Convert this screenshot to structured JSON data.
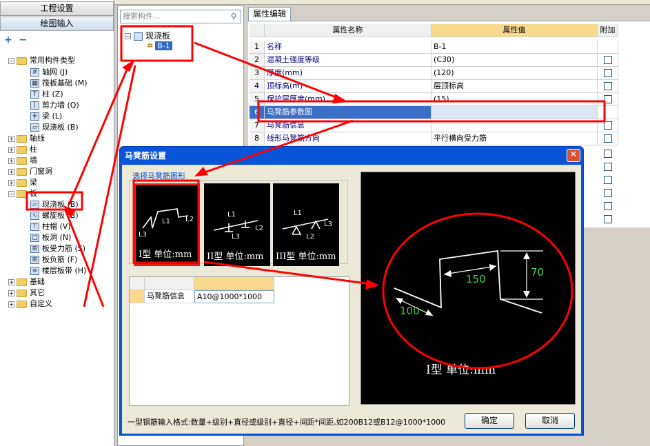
{
  "left_panel": {
    "btn_project": "工程设置",
    "btn_draw": "绘图输入",
    "tools": [
      "+",
      "−"
    ],
    "tree": [
      {
        "id": "n1",
        "exp": "−",
        "folder": true,
        "label": "常用构件类型"
      },
      {
        "id": "n2",
        "icon": "grid",
        "label": "轴网 (J)"
      },
      {
        "id": "n3",
        "icon": "raft",
        "label": "筏板基础 (M)"
      },
      {
        "id": "n4",
        "icon": "column",
        "label": "柱 (Z)"
      },
      {
        "id": "n5",
        "icon": "wall",
        "label": "剪力墙 (Q)"
      },
      {
        "id": "n6",
        "icon": "beam",
        "label": "梁 (L)"
      },
      {
        "id": "n7",
        "icon": "slab",
        "label": "现浇板 (B)"
      },
      {
        "id": "n8",
        "exp": "+",
        "folder": true,
        "label": "轴线"
      },
      {
        "id": "n9",
        "exp": "+",
        "folder": true,
        "label": "柱"
      },
      {
        "id": "n10",
        "exp": "+",
        "folder": true,
        "label": "墙"
      },
      {
        "id": "n11",
        "exp": "+",
        "folder": true,
        "label": "门窗洞"
      },
      {
        "id": "n12",
        "exp": "+",
        "folder": true,
        "label": "梁"
      },
      {
        "id": "n13",
        "exp": "−",
        "folder": true,
        "label": "板"
      },
      {
        "id": "n14",
        "icon": "slab",
        "label": "现浇板 (B)"
      },
      {
        "id": "n15",
        "icon": "spiral",
        "label": "螺旋板 (B)"
      },
      {
        "id": "n16",
        "icon": "cap",
        "label": "柱帽 (V)"
      },
      {
        "id": "n17",
        "icon": "hole",
        "label": "板洞 (N)"
      },
      {
        "id": "n18",
        "icon": "rebar",
        "label": "板受力筋 (S)"
      },
      {
        "id": "n19",
        "icon": "rebar",
        "label": "板负筋 (F)"
      },
      {
        "id": "n20",
        "icon": "band",
        "label": "楼层板带 (H)"
      },
      {
        "id": "n21",
        "exp": "+",
        "folder": true,
        "label": "基础"
      },
      {
        "id": "n22",
        "exp": "+",
        "folder": true,
        "label": "其它"
      },
      {
        "id": "n23",
        "exp": "+",
        "folder": true,
        "label": "自定义"
      }
    ]
  },
  "mid_panel": {
    "search_placeholder": "搜索构件...",
    "node_parent": "现浇板",
    "node_child": "B-1"
  },
  "property_grid": {
    "tab": "属性编辑",
    "headers": {
      "name": "属性名称",
      "value": "属性值",
      "add": "附加"
    },
    "rows": [
      {
        "num": "1",
        "name": "名称",
        "value": "B-1",
        "check": false
      },
      {
        "num": "2",
        "name": "混凝土强度等级",
        "value": "(C30)",
        "check": true
      },
      {
        "num": "3",
        "name": "厚度(mm)",
        "value": "(120)",
        "check": true
      },
      {
        "num": "4",
        "name": "顶标高(m)",
        "value": "层顶标高",
        "check": true
      },
      {
        "num": "5",
        "name": "保护层厚度(mm)",
        "value": "(15)",
        "check": true
      },
      {
        "num": "6",
        "name": "马凳筋参数图",
        "value": "",
        "check": false
      },
      {
        "num": "7",
        "name": "马凳筋信息",
        "value": "",
        "check": true
      },
      {
        "num": "8",
        "name": "线形马凳筋方向",
        "value": "平行横向受力筋",
        "check": true
      }
    ]
  },
  "dialog": {
    "title": "马凳筋设置",
    "close": "✕",
    "select_label": "选择马凳筋图形",
    "thumbs": [
      {
        "caption": "I型 单位:mm",
        "labels": [
          "L1",
          "L2",
          "L3"
        ]
      },
      {
        "caption": "II型 单位:mm",
        "labels": [
          "L1",
          "L2",
          "L3"
        ]
      },
      {
        "caption": "III型 单位:mm",
        "labels": [
          "L1",
          "L2",
          "L3"
        ]
      }
    ],
    "info_row_label": "马凳筋信息",
    "info_row_value": "A10@1000*1000",
    "preview": {
      "dim_a": "150",
      "dim_b": "70",
      "dim_c": "100",
      "caption": "I型 单位:mm"
    },
    "hint": "一型钢筋输入格式:数量+级别+直径或级别+直径+间距*间距,如200B12或B12@1000*1000",
    "ok": "确定",
    "cancel": "取消"
  },
  "colors": {
    "accent": "#0a54d8",
    "annotation": "#ff0000",
    "header_value": "#f9d98e",
    "selection": "#3a6fc7"
  }
}
